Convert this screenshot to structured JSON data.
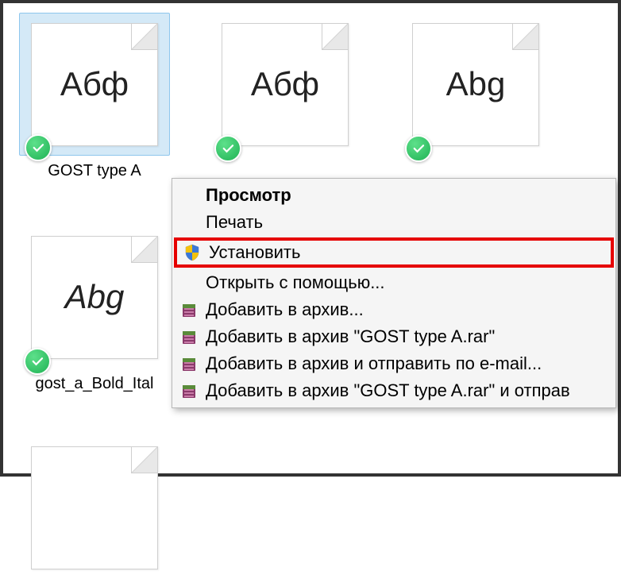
{
  "files": [
    {
      "preview": "Абф",
      "label": "GOST type A",
      "selected": true,
      "italic": false
    },
    {
      "preview": "Абф",
      "label": "",
      "selected": false,
      "italic": false
    },
    {
      "preview": "Abg",
      "label": "",
      "selected": false,
      "italic": false
    },
    {
      "preview": "Abg",
      "label": "gost_a_Bold_Ital",
      "selected": false,
      "italic": true
    }
  ],
  "menu": {
    "preview": "Просмотр",
    "print": "Печать",
    "install": "Установить",
    "open_with": "Открыть с помощью...",
    "add_archive": "Добавить в архив...",
    "add_archive_named": "Добавить в архив \"GOST type A.rar\"",
    "add_archive_email": "Добавить в архив и отправить по e-mail...",
    "add_archive_named_send": "Добавить в архив \"GOST type A.rar\" и отправ"
  }
}
